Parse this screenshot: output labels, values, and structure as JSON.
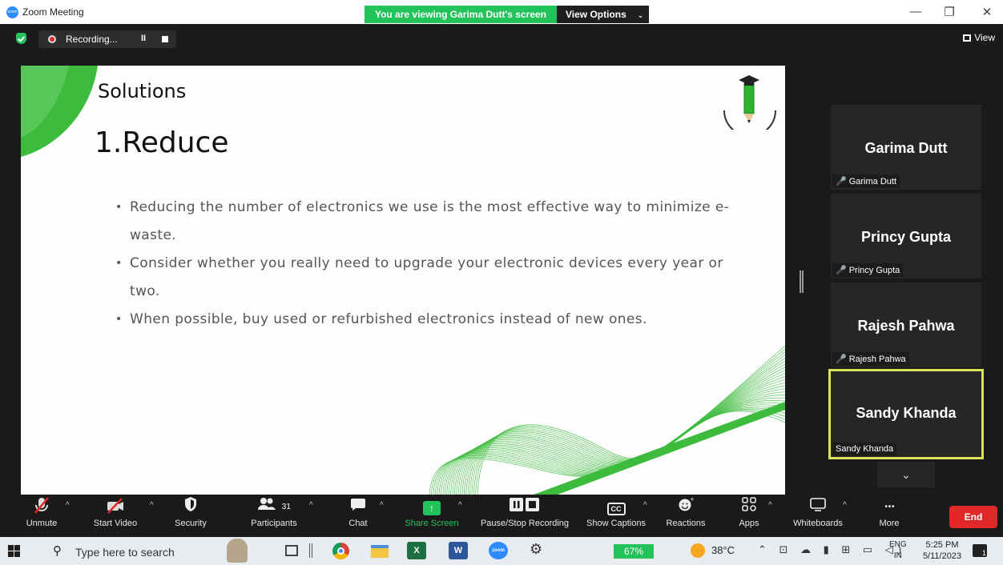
{
  "window": {
    "app_title": "Zoom Meeting",
    "app_logo_text": "zoom",
    "viewing_banner": "You are viewing Garima Dutt's screen",
    "view_options": "View Options",
    "minimize": "—",
    "restore": "❐",
    "close": "✕"
  },
  "recording": {
    "label": "Recording...",
    "pause_icon": "II"
  },
  "view_button": "View",
  "slide": {
    "heading": "Solutions",
    "title": "1.Reduce",
    "bullets": [
      "Reducing the number of electronics we use is the most effective way to minimize e-waste.",
      "Consider whether you really need to upgrade your electronic devices every year or two.",
      "When possible, buy used or refurbished electronics instead of new ones."
    ],
    "accent_color": "#3dbb3d"
  },
  "participants": [
    {
      "name": "Garima Dutt",
      "label": "Garima Dutt",
      "muted": true
    },
    {
      "name": "Princy Gupta",
      "label": "Princy Gupta",
      "muted": true
    },
    {
      "name": "Rajesh Pahwa",
      "label": "Rajesh Pahwa",
      "muted": true
    },
    {
      "name": "Sandy Khanda",
      "label": "Sandy Khanda",
      "muted": false,
      "active_speaker": true
    }
  ],
  "toolbar": {
    "unmute": "Unmute",
    "start_video": "Start Video",
    "security": "Security",
    "participants": "Participants",
    "participants_count": "31",
    "chat": "Chat",
    "share_screen": "Share Screen",
    "pause_stop_recording": "Pause/Stop Recording",
    "show_captions": "Show Captions",
    "cc_icon": "CC",
    "reactions": "Reactions",
    "apps": "Apps",
    "whiteboards": "Whiteboards",
    "more": "More",
    "more_icon": "• • •",
    "end": "End"
  },
  "taskbar": {
    "search_placeholder": "Type here to search",
    "battery": "67%",
    "temperature": "38°C",
    "lang_line1": "ENG",
    "lang_line2": "IN",
    "time": "5:25 PM",
    "date": "5/11/2023",
    "notification_count": "1",
    "excel_letter": "X",
    "word_letter": "W",
    "zoom_letter": "zoom"
  },
  "colors": {
    "share_green": "#23c35b",
    "end_red": "#e02828",
    "active_speaker_border": "#d9e35a"
  }
}
